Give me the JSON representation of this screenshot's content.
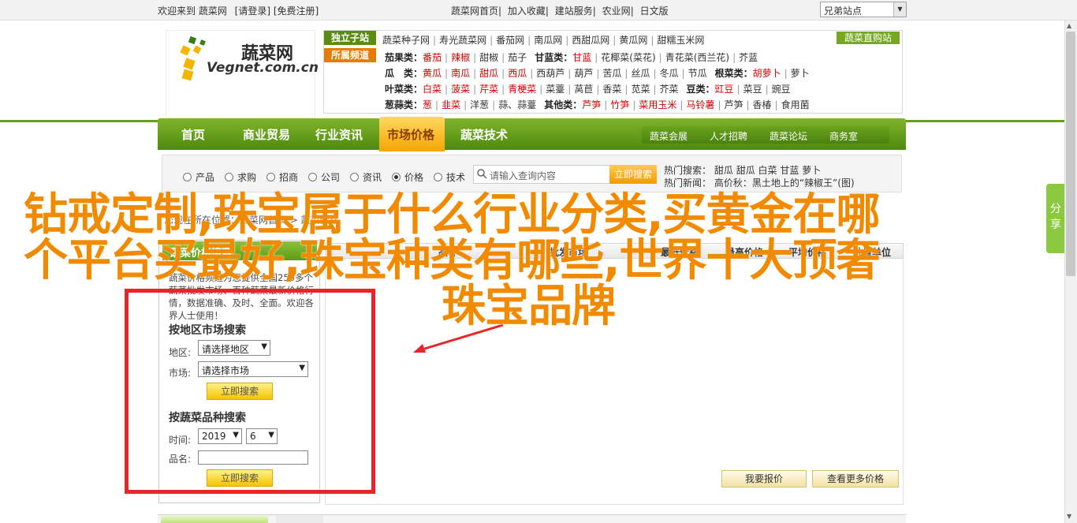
{
  "topbar": {
    "welcome": "欢迎来到 蔬菜网",
    "login": "[请登录]",
    "register": "[免费注册]",
    "links": [
      "蔬菜网首页",
      "加入收藏",
      "建站服务",
      "农业网",
      "日文版"
    ],
    "friend_select": "兄弟站点"
  },
  "logo": {
    "cn": "蔬菜网",
    "en": "Vegnet.com.cn"
  },
  "categories": {
    "tag_independent": "独立子站",
    "tag_channel": "所属频道",
    "subsites": [
      "蔬菜种子网",
      "寿光蔬菜网",
      "番茄网",
      "南瓜网",
      "西甜瓜网",
      "黄瓜网",
      "甜糯玉米网"
    ],
    "direct_link": "蔬菜直购站",
    "rows": [
      {
        "label": "茄果类：",
        "items": [
          "番茄",
          "辣椒",
          "甜椒",
          "茄子"
        ],
        "red": [
          0,
          1
        ],
        "label2": "甘蓝类：",
        "items2": [
          "甘蓝",
          "花椰菜(菜花)",
          "青花菜(西兰花)",
          "芥蓝"
        ],
        "red2": [
          0
        ]
      },
      {
        "label": "瓜　类：",
        "items": [
          "黄瓜",
          "南瓜",
          "甜瓜",
          "西瓜",
          "西葫芦",
          "葫芦",
          "苦瓜",
          "丝瓜",
          "冬瓜",
          "节瓜"
        ],
        "red": [
          0,
          1,
          2,
          3
        ],
        "label2": "根菜类：",
        "items2": [
          "胡萝卜",
          "萝卜"
        ],
        "red2": [
          0
        ]
      },
      {
        "label": "叶菜类：",
        "items": [
          "白菜",
          "菠菜",
          "芹菜",
          "青梗菜",
          "菜薹",
          "莴苣",
          "香菜",
          "苋菜",
          "芥菜"
        ],
        "red": [
          0,
          1,
          2,
          3
        ],
        "label2": "豆类：",
        "items2": [
          "豇豆",
          "菜豆",
          "豌豆"
        ],
        "red2": [
          0
        ]
      },
      {
        "label": "葱蒜类：",
        "items": [
          "葱",
          "韭菜",
          "洋葱",
          "蒜、蒜薹"
        ],
        "red": [
          0,
          1
        ],
        "label2": "其他类：",
        "items2": [
          "芦笋",
          "竹笋",
          "菜用玉米",
          "马铃薯",
          "芦笋",
          "香椿",
          "食用菌"
        ],
        "red2": [
          0,
          1,
          2,
          3
        ]
      }
    ]
  },
  "nav": {
    "items": [
      "首页",
      "商业贸易",
      "行业资讯",
      "市场价格",
      "蔬菜技术"
    ],
    "active_index": 3,
    "sub_items": [
      "蔬菜会展",
      "人才招聘",
      "蔬菜论坛",
      "商务室"
    ]
  },
  "search": {
    "options": [
      "产品",
      "求购",
      "招商",
      "公司",
      "资讯",
      "价格",
      "技术"
    ],
    "selected_index": 5,
    "placeholder": "请输入查询内容",
    "button": "立即搜索",
    "hot_label": "热门搜索：",
    "hot_items": [
      "甜瓜",
      "甜瓜",
      "白菜",
      "甘蓝",
      "萝卜"
    ],
    "news_label": "热门新闻：",
    "news_text": "高价秋：黑土地上的“辣椒王”(图)"
  },
  "breadcrumb": "您现在所在位置：蔬菜网首页 > 蔬菜价格",
  "sidebar": {
    "title": "蔬菜价格搜索",
    "intro": "蔬菜价格频道为您提供全国250多个蔬菜批发市场、百种蔬菜最新价格行情，数据准确、及时、全面。欢迎各界人士使用！",
    "region_heading": "按地区市场搜索",
    "region_label": "地区:",
    "region_value": "请选择地区",
    "market_label": "市场:",
    "market_value": "请选择市场",
    "search_btn": "立即搜索",
    "variety_heading": "按蔬菜品种搜索",
    "time_label": "时间:",
    "year_value": "2019",
    "month_value": "6",
    "name_label": "品名:",
    "search_btn2": "立即搜索"
  },
  "table": {
    "headers": [
      "品种",
      "批发市场",
      "最低价格",
      "最高价格",
      "平均价格",
      "计量单位"
    ]
  },
  "actions": {
    "report_price": "我要报价",
    "more_prices": "查看更多价格"
  },
  "share": "分享",
  "overlay": {
    "line1": "钻戒定制,珠宝属于什么行业分类,买黄金在哪",
    "line2": "个平台买最好,珠宝种类有哪些,世界十大顶奢",
    "line3": "珠宝品牌"
  },
  "colors": {
    "brand_green": "#6a9e1f",
    "accent_orange": "#f28a00",
    "highlight_red": "#e8262a"
  }
}
